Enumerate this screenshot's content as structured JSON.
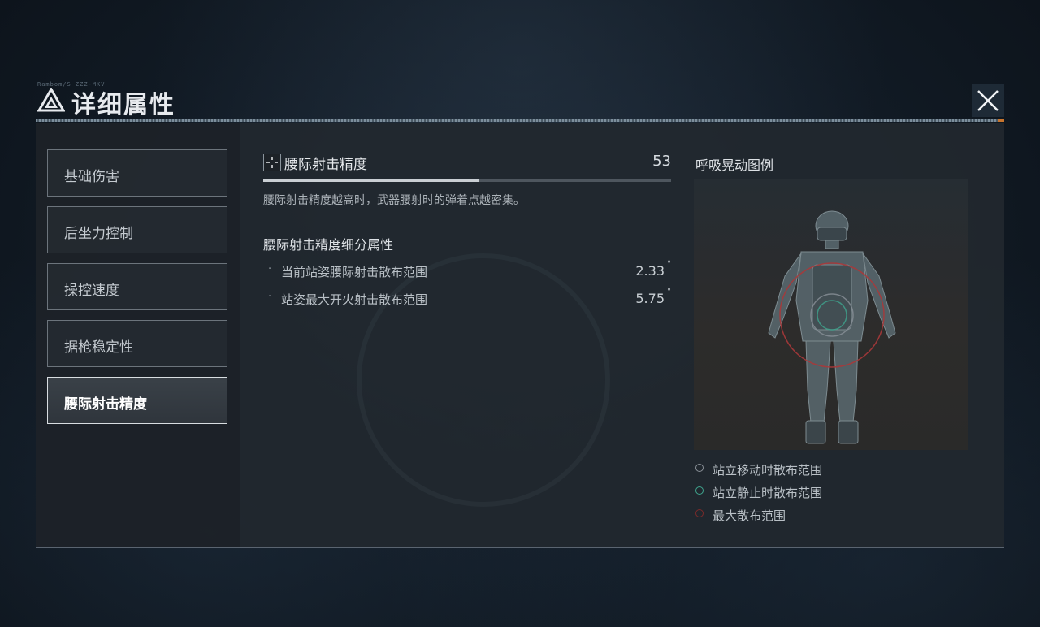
{
  "header": {
    "tag": "Rambom/S ZZZ-MKV",
    "title": "详细属性",
    "close_icon": "close-icon"
  },
  "sidebar": {
    "items": [
      {
        "label": "基础伤害",
        "active": false
      },
      {
        "label": "后坐力控制",
        "active": false
      },
      {
        "label": "操控速度",
        "active": false
      },
      {
        "label": "据枪稳定性",
        "active": false
      },
      {
        "label": "腰际射击精度",
        "active": true
      }
    ]
  },
  "stat": {
    "icon": "crosshair-icon",
    "name": "腰际射击精度",
    "value": "53",
    "progress": 0.53,
    "description": "腰际射击精度越高时，武器腰射时的弹着点越密集。",
    "sub_title": "腰际射击精度细分属性",
    "sub_items": [
      {
        "label": "当前站姿腰际射击散布范围",
        "value": "2.33",
        "unit": "°"
      },
      {
        "label": "站姿最大开火射击散布范围",
        "value": "5.75",
        "unit": "°"
      }
    ]
  },
  "legend": {
    "title": "呼吸晃动图例",
    "items": [
      {
        "label": "站立移动时散布范围",
        "color": "#8a9198"
      },
      {
        "label": "站立静止时散布范围",
        "color": "#3fa58e"
      },
      {
        "label": "最大散布范围",
        "color": "#7a2a2a"
      }
    ]
  },
  "colors": {
    "accent": "#c8752e",
    "max_spread_ring": "#a8383a",
    "panel_bg": "#22282f"
  }
}
